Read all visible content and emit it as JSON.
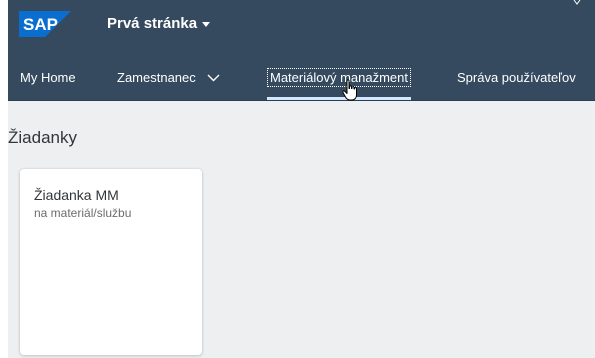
{
  "shell": {
    "logo_text": "SAP",
    "app_title": "Prvá stránka",
    "title_icon": "caret-down-icon",
    "header_color": "#354a5f",
    "logo_color": "#0a6ed1"
  },
  "nav": {
    "items": [
      {
        "label": "My Home"
      },
      {
        "label": "Zamestnanec",
        "icon": "chevron-down-icon"
      },
      {
        "label": "Materiálový manažment",
        "active": true
      },
      {
        "label": "Správa používateľov"
      }
    ],
    "active_indicator_color": "#d1e8ff"
  },
  "cursor": {
    "icon": "hand-pointer-icon"
  },
  "content": {
    "background_color": "#edeff0",
    "section_title": "Žiadanky",
    "tiles": [
      {
        "title": "Žiadanka MM",
        "subtitle": "na materiál/službu"
      }
    ]
  }
}
